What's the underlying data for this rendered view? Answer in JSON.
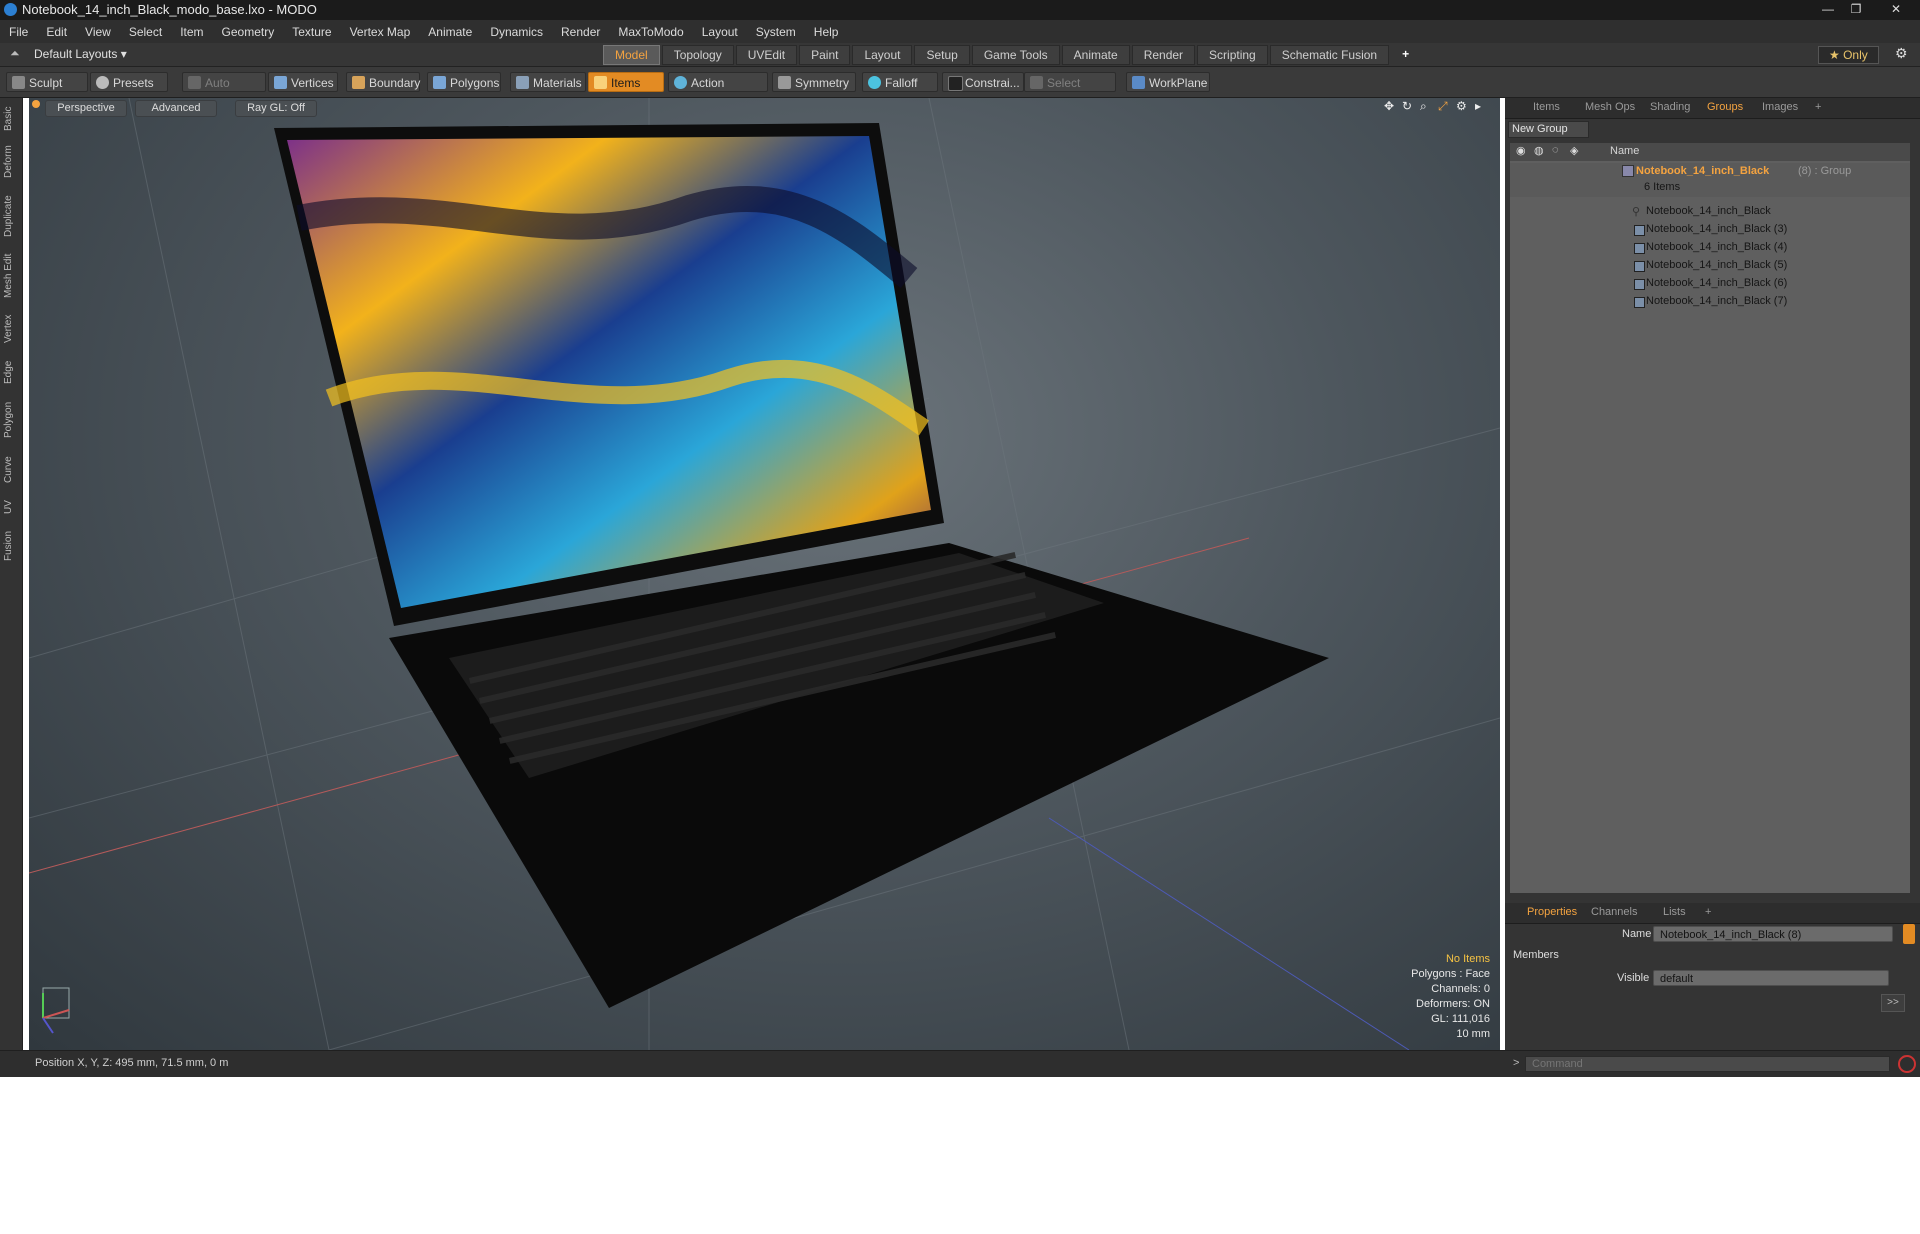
{
  "window": {
    "title": "Notebook_14_inch_Black_modo_base.lxo - MODO"
  },
  "menu": [
    "File",
    "Edit",
    "View",
    "Select",
    "Item",
    "Geometry",
    "Texture",
    "Vertex Map",
    "Animate",
    "Dynamics",
    "Render",
    "MaxToModo",
    "Layout",
    "System",
    "Help"
  ],
  "layout_bar": {
    "layout_label": "Default Layouts ▾",
    "tabs": [
      "Model",
      "Topology",
      "UVEdit",
      "Paint",
      "Layout",
      "Setup",
      "Game Tools",
      "Animate",
      "Render",
      "Scripting",
      "Schematic Fusion"
    ],
    "active_tab": "Model",
    "add": "+",
    "only": "★ Only"
  },
  "toolbar": {
    "sculpt": "Sculpt",
    "presets": "Presets",
    "auto_select": "Auto Select",
    "vertices": "Vertices",
    "boundary": "Boundary",
    "polygons": "Polygons",
    "materials": "Materials",
    "items": "Items",
    "action_center": "Action Center",
    "symmetry": "Symmetry",
    "falloff": "Falloff",
    "constraint": "Constrai...",
    "select_through": "Select Through",
    "workplane": "WorkPlane"
  },
  "left_tabs": [
    "Basic",
    "Deform",
    "Duplicate",
    "Mesh Edit",
    "Vertex",
    "Edge",
    "Polygon",
    "Curve",
    "UV",
    "Fusion"
  ],
  "viewport": {
    "perspective": "Perspective",
    "advanced": "Advanced",
    "raygl": "Ray GL: Off",
    "hud": {
      "no_items": "No Items",
      "polygons": "Polygons : Face",
      "channels": "Channels: 0",
      "deformers": "Deformers: ON",
      "gl": "GL: 111,016",
      "scale": "10 mm"
    }
  },
  "right_panel": {
    "tabs": [
      "Items",
      "Mesh Ops",
      "Shading",
      "Groups",
      "Images"
    ],
    "active_tab": "Groups",
    "new_group": "New Group",
    "name_header": "Name",
    "group": {
      "name": "Notebook_14_inch_Black",
      "suffix": "(8) : Group",
      "count": "6 Items"
    },
    "children": [
      "Notebook_14_inch_Black",
      "Notebook_14_inch_Black (3)",
      "Notebook_14_inch_Black (4)",
      "Notebook_14_inch_Black (5)",
      "Notebook_14_inch_Black (6)",
      "Notebook_14_inch_Black (7)"
    ],
    "prop_tabs": [
      "Properties",
      "Channels",
      "Lists"
    ],
    "name_label": "Name",
    "name_value": "Notebook_14_inch_Black (8)",
    "members": "Members",
    "visible_label": "Visible",
    "visible_value": "default",
    "more": ">>"
  },
  "status": {
    "position": "Position X, Y, Z:   495 mm, 71.5 mm, 0 m"
  },
  "command": {
    "prompt": ">",
    "placeholder": "Command"
  },
  "colors": {
    "accent": "#f4a340",
    "active_tool": "#e38b23"
  }
}
